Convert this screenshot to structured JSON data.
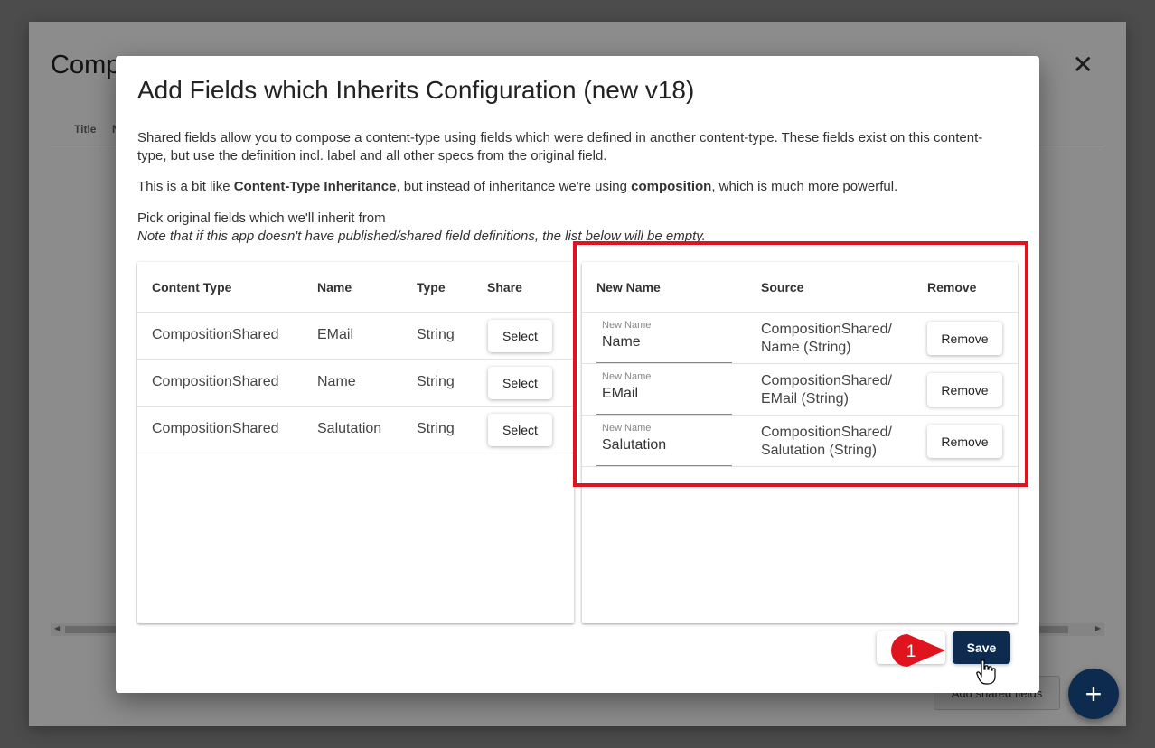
{
  "background": {
    "title": "Comp",
    "col_title": "Title",
    "col_n": "N",
    "add_shared_label": "Add shared fields",
    "close_glyph": "✕",
    "fab_glyph": "+"
  },
  "dialog": {
    "title": "Add Fields which Inherits Configuration (new v18)",
    "desc1": "Shared fields allow you to compose a content-type using fields which were defined in another content-type. These fields exist on this content-type, but use the definition incl. label and all other specs from the original field.",
    "desc2_pre": "This is a bit like ",
    "desc2_bold1": "Content-Type Inheritance",
    "desc2_mid": ", but instead of inheritance we're using ",
    "desc2_bold2": "composition",
    "desc2_post": ", which is much more powerful.",
    "desc3": "Pick original fields which we'll inherit from",
    "desc3_note": "Note that if this app doesn't have published/shared field definitions, the list below will be empty."
  },
  "left_table": {
    "headers": {
      "content_type": "Content Type",
      "name": "Name",
      "type": "Type",
      "share": "Share"
    },
    "rows": [
      {
        "content_type": "CompositionShared",
        "name": "EMail",
        "type": "String",
        "action": "Select"
      },
      {
        "content_type": "CompositionShared",
        "name": "Name",
        "type": "String",
        "action": "Select"
      },
      {
        "content_type": "CompositionShared",
        "name": "Salutation",
        "type": "String",
        "action": "Select"
      }
    ]
  },
  "right_table": {
    "headers": {
      "new_name": "New Name",
      "source": "Source",
      "remove": "Remove"
    },
    "rows": [
      {
        "field_label": "New Name",
        "value": "Name",
        "source_line1": "CompositionShared/",
        "source_line2": "Name (String)",
        "action": "Remove"
      },
      {
        "field_label": "New Name",
        "value": "EMail",
        "source_line1": "CompositionShared/",
        "source_line2": "EMail (String)",
        "action": "Remove"
      },
      {
        "field_label": "New Name",
        "value": "Salutation",
        "source_line1": "CompositionShared/",
        "source_line2": "Salutation (String)",
        "action": "Remove"
      }
    ]
  },
  "footer": {
    "save_label": "Save",
    "marker_number": "1"
  },
  "colors": {
    "primary": "#0d2b4e",
    "highlight": "#e0141e"
  }
}
